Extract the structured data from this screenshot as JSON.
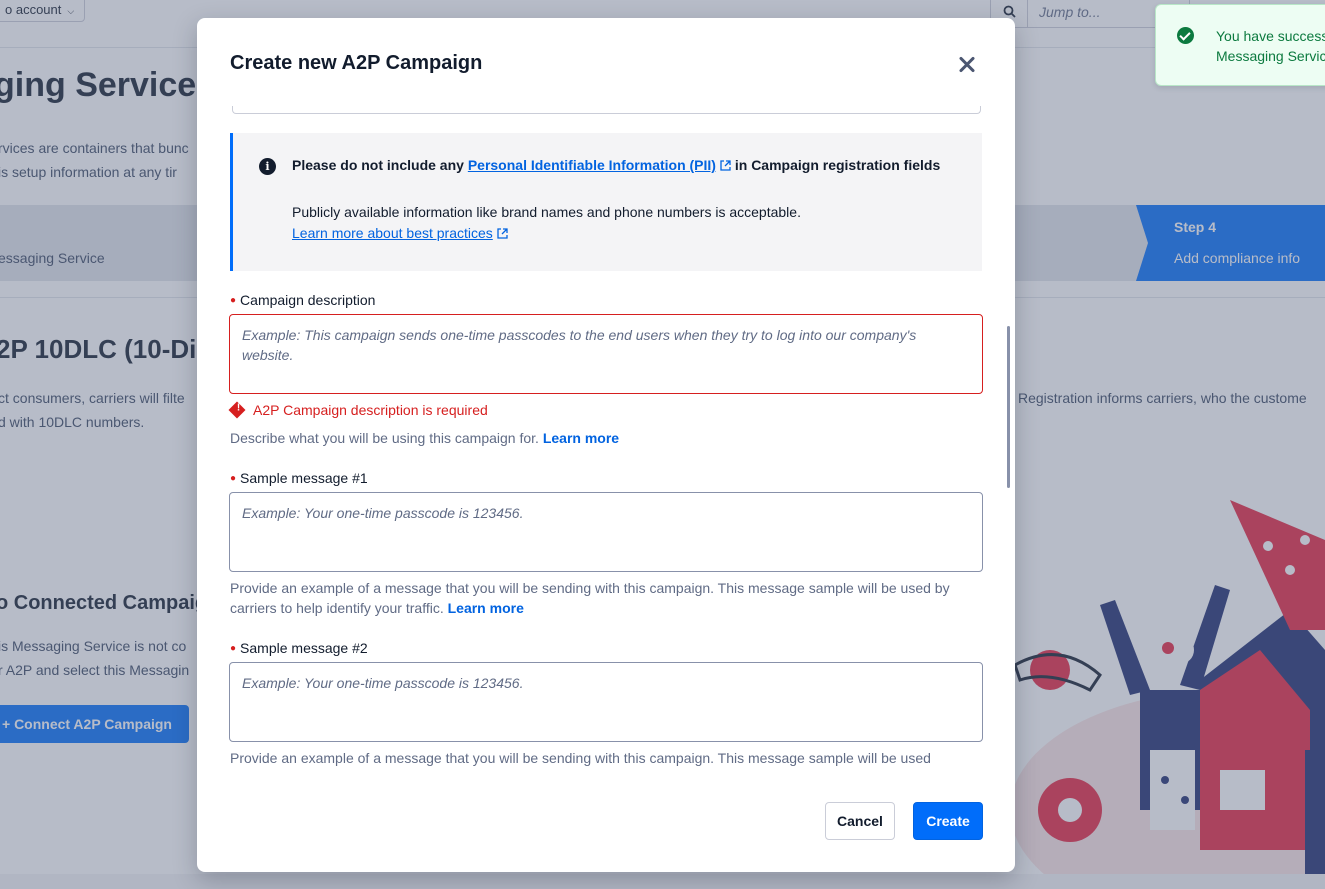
{
  "background": {
    "account_button": "o account",
    "jump_placeholder": "Jump to...",
    "page_title": "ging Service",
    "intro_line1": "rvices are containers that bunc",
    "intro_line2": "is setup information at any tir",
    "step_prev_sub": "essaging Service",
    "step4_label": "Step 4",
    "step4_sub": "Add compliance info",
    "section_title": "2P 10DLC (10-Dig",
    "section_line1": "ct consumers, carriers will filte",
    "section_line2": "d with 10DLC numbers.",
    "registration_text": "Registration informs carriers, who the custome",
    "no_campaign_title": "o Connected Campaig",
    "no_campaign_line1": "is Messaging Service is not co",
    "no_campaign_line2": "r A2P and select this Messagin",
    "connect_button": "+ Connect A2P Campaign"
  },
  "toast": {
    "line1": "You have success",
    "line2": "Messaging Servic"
  },
  "modal": {
    "title": "Create new A2P Campaign",
    "callout": {
      "title_prefix": "Please do not include any ",
      "title_link": "Personal Identifiable Information (PII)",
      "title_suffix": " in Campaign registration fields",
      "text": "Publicly available information like brand names and phone numbers is acceptable.",
      "link": "Learn more about best practices"
    },
    "campaign_description": {
      "label": "Campaign description",
      "placeholder": "Example: This campaign sends one-time passcodes to the end users when they try to log into our company's website.",
      "error": "A2P Campaign description is required",
      "help": "Describe what you will be using this campaign for.",
      "learn_more": "Learn more"
    },
    "sample1": {
      "label": "Sample message #1",
      "placeholder": "Example: Your one-time passcode is 123456.",
      "help": "Provide an example of a message that you will be sending with this campaign. This message sample will be used by carriers to help identify your traffic.",
      "learn_more": "Learn more"
    },
    "sample2": {
      "label": "Sample message #2",
      "placeholder": "Example: Your one-time passcode is 123456.",
      "help": "Provide an example of a message that you will be sending with this campaign. This message sample will be used"
    },
    "cancel_label": "Cancel",
    "create_label": "Create"
  },
  "colors": {
    "primary": "#006dfa",
    "link": "#0263e0",
    "error": "#d61f1f",
    "success": "#0c7a3f"
  }
}
